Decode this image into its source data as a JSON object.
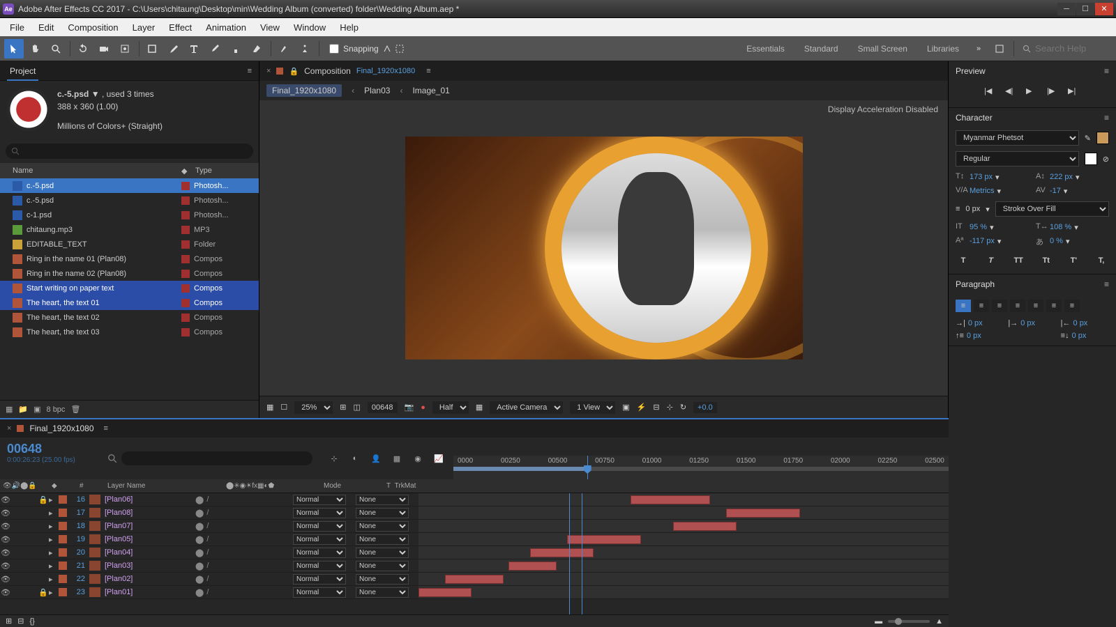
{
  "title": "Adobe After Effects CC 2017 - C:\\Users\\chitaung\\Desktop\\min\\Wedding Album (converted) folder\\Wedding Album.aep *",
  "menu": [
    "File",
    "Edit",
    "Composition",
    "Layer",
    "Effect",
    "Animation",
    "View",
    "Window",
    "Help"
  ],
  "toolbar": {
    "snapping": "Snapping",
    "workspaces": [
      "Essentials",
      "Standard",
      "Small Screen",
      "Libraries"
    ],
    "search_placeholder": "Search Help"
  },
  "project": {
    "title": "Project",
    "asset": {
      "name": "c.-5.psd",
      "dropdown": "▼",
      "used": ", used 3 times",
      "dims": "388 x 360 (1.00)",
      "colors": "Millions of Colors+ (Straight)"
    },
    "cols": {
      "name": "Name",
      "type": "Type"
    },
    "rows": [
      {
        "name": "c.-5.psd",
        "type": "Photosh...",
        "icon": "psd",
        "sel": true
      },
      {
        "name": "c.-5.psd",
        "type": "Photosh...",
        "icon": "psd"
      },
      {
        "name": "c-1.psd",
        "type": "Photosh...",
        "icon": "psd"
      },
      {
        "name": "chitaung.mp3",
        "type": "MP3",
        "icon": "mp3"
      },
      {
        "name": "EDITABLE_TEXT",
        "type": "Folder",
        "icon": "folder"
      },
      {
        "name": "Ring in the name 01 (Plan08)",
        "type": "Compos",
        "icon": "comp"
      },
      {
        "name": "Ring in the name 02 (Plan08)",
        "type": "Compos",
        "icon": "comp"
      },
      {
        "name": "Start writing on paper text",
        "type": "Compos",
        "icon": "comp",
        "hl": true
      },
      {
        "name": "The heart, the text 01",
        "type": "Compos",
        "icon": "comp",
        "hl": true
      },
      {
        "name": "The heart, the text 02",
        "type": "Compos",
        "icon": "comp"
      },
      {
        "name": "The heart, the text 03",
        "type": "Compos",
        "icon": "comp"
      }
    ],
    "footer_bpc": "8 bpc"
  },
  "comp": {
    "label": "Composition",
    "name": "Final_1920x1080",
    "crumbs": [
      "Final_1920x1080",
      "Plan03",
      "Image_01"
    ],
    "accel": "Display Acceleration Disabled",
    "footer": {
      "zoom": "25%",
      "tc": "00648",
      "res": "Half",
      "camera": "Active Camera",
      "view": "1 View",
      "exp": "+0.0"
    }
  },
  "preview": {
    "title": "Preview"
  },
  "character": {
    "title": "Character",
    "font": "Myanmar Phetsot",
    "style": "Regular",
    "size": "173 px",
    "leading": "222 px",
    "kerning": "Metrics",
    "tracking": "-17",
    "stroke_w": "0 px",
    "stroke_opt": "Stroke Over Fill",
    "vscale": "95 %",
    "hscale": "108 %",
    "baseline": "-117 px",
    "tsume": "0 %",
    "opts": [
      "T",
      "T",
      "TT",
      "Tt",
      "T'",
      "T,"
    ]
  },
  "paragraph": {
    "title": "Paragraph",
    "indent_left": "0 px",
    "indent_right": "0 px",
    "indent_first": "0 px",
    "space_before": "0 px",
    "space_after": "0 px"
  },
  "timeline": {
    "name": "Final_1920x1080",
    "tc": "00648",
    "frames": "0:00:26:23 (25.00 fps)",
    "ruler": [
      "0000",
      "00250",
      "00500",
      "00750",
      "01000",
      "01250",
      "01500",
      "01750",
      "02000",
      "02250",
      "02500"
    ],
    "cols": {
      "num": "#",
      "layer": "Layer Name",
      "mode": "Mode",
      "trk": "TrkMat",
      "t": "T"
    },
    "layers": [
      {
        "n": 16,
        "name": "[Plan06]",
        "mode": "Normal",
        "trk": "None",
        "lock": true,
        "clip": {
          "l": 40,
          "w": 15
        }
      },
      {
        "n": 17,
        "name": "[Plan08]",
        "mode": "Normal",
        "trk": "None",
        "clip": {
          "l": 58,
          "w": 14
        }
      },
      {
        "n": 18,
        "name": "[Plan07]",
        "mode": "Normal",
        "trk": "None",
        "clip": {
          "l": 48,
          "w": 12
        }
      },
      {
        "n": 19,
        "name": "[Plan05]",
        "mode": "Normal",
        "trk": "None",
        "clip": {
          "l": 28,
          "w": 14
        }
      },
      {
        "n": 20,
        "name": "[Plan04]",
        "mode": "Normal",
        "trk": "None",
        "clip": {
          "l": 21,
          "w": 12
        }
      },
      {
        "n": 21,
        "name": "[Plan03]",
        "mode": "Normal",
        "trk": "None",
        "clip": {
          "l": 17,
          "w": 9
        }
      },
      {
        "n": 22,
        "name": "[Plan02]",
        "mode": "Normal",
        "trk": "None",
        "clip": {
          "l": 5,
          "w": 11
        }
      },
      {
        "n": 23,
        "name": "[Plan01]",
        "mode": "Normal",
        "trk": "None",
        "lock": true,
        "clip": {
          "l": 0,
          "w": 10
        }
      }
    ]
  }
}
